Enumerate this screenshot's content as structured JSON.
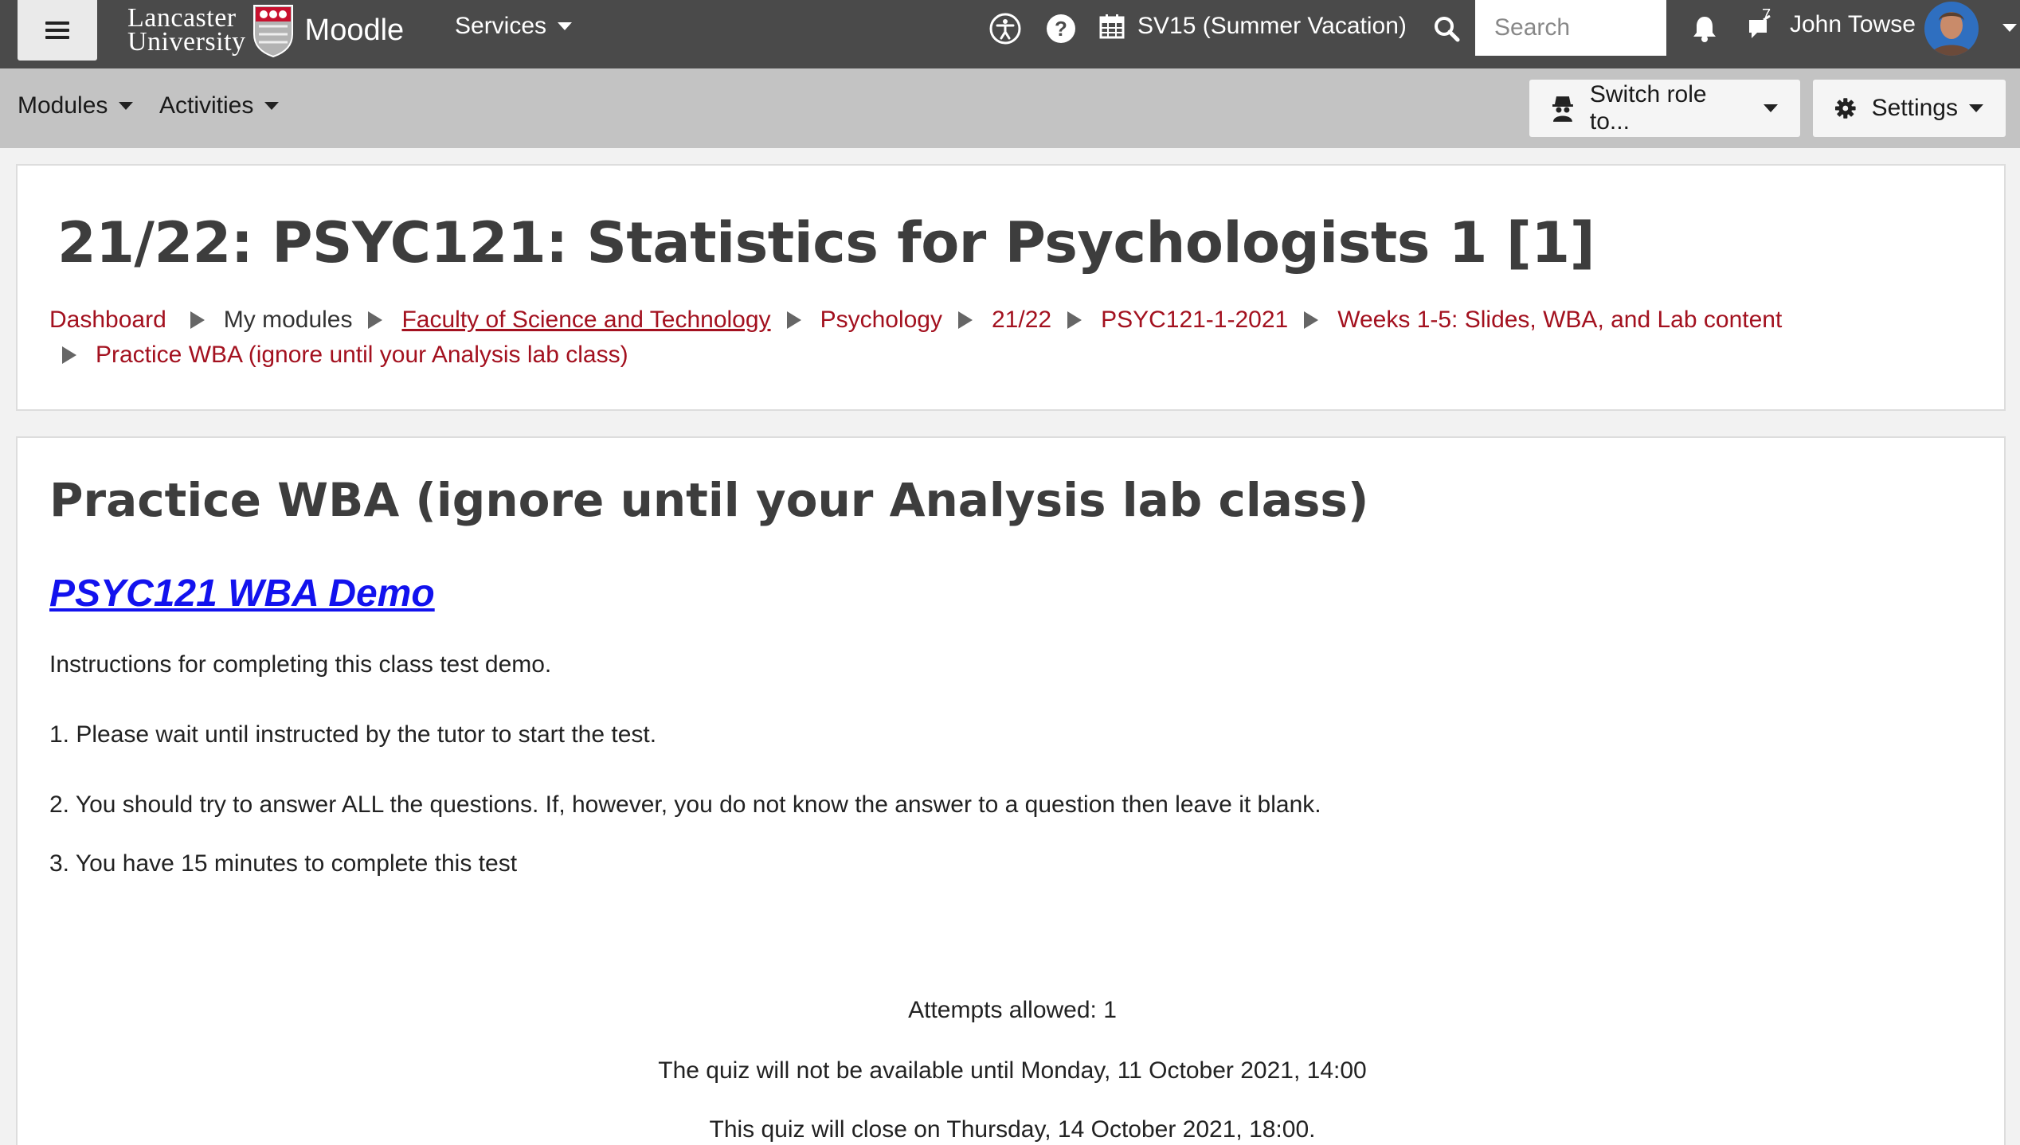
{
  "topbar": {
    "logo_line1": "Lancaster",
    "logo_line2": "University",
    "site_name": "Moodle",
    "services_label": "Services",
    "term_label": "SV15 (Summer Vacation)",
    "search_placeholder": "Search",
    "message_count": "7",
    "user_name": "John Towse",
    "icons": [
      "menu-icon",
      "accessibility-icon",
      "help-icon",
      "calendar-icon",
      "search-icon",
      "bell-icon",
      "chat-icon"
    ]
  },
  "subbar": {
    "modules_label": "Modules",
    "activities_label": "Activities",
    "switch_role_label": "Switch role to...",
    "settings_label": "Settings"
  },
  "header": {
    "course_title": "21/22: PSYC121: Statistics for Psychologists 1 [1]",
    "breadcrumb": [
      "Dashboard",
      "My modules",
      "Faculty of Science and Technology",
      "Psychology",
      "21/22",
      "PSYC121-1-2021",
      "Weeks 1-5: Slides, WBA, and Lab content",
      "Practice WBA (ignore until your Analysis lab class)"
    ]
  },
  "main": {
    "activity_title": "Practice WBA (ignore until your Analysis lab class)",
    "demo_link": "PSYC121 WBA Demo",
    "intro": "Instructions for completing this class test demo.",
    "instructions": [
      "1. Please wait until instructed by the tutor to start the test.",
      "2. You should try to answer ALL the questions. If, however, you do not know the answer to a question then leave it blank.",
      "3. You have 15 minutes to complete this test"
    ],
    "attempts": "Attempts allowed: 1",
    "open_date": "The quiz will not be available until Monday, 11 October 2021, 14:00",
    "close_date": "This quiz will close on Thursday, 14 October 2021, 18:00."
  },
  "colors": {
    "topbar": "#4a4a4a",
    "subbar": "#c3c3c3",
    "link_red": "#a3111f",
    "link_blue": "#1212ee"
  }
}
